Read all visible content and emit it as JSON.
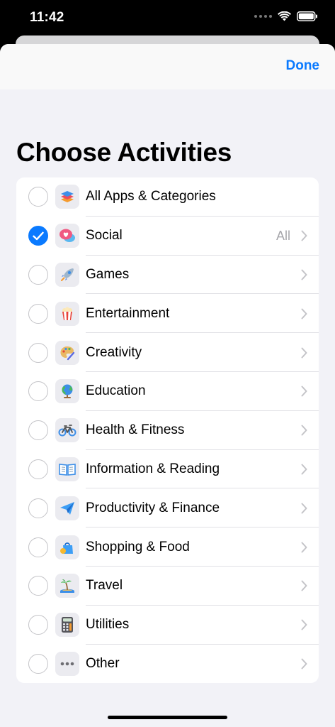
{
  "status": {
    "time": "11:42"
  },
  "nav": {
    "done_label": "Done"
  },
  "title": "Choose Activities",
  "rows": [
    {
      "label": "All Apps & Categories",
      "detail": "",
      "checked": false,
      "icon": "stack-icon",
      "chevron": false
    },
    {
      "label": "Social",
      "detail": "All",
      "checked": true,
      "icon": "social-bubbles-icon",
      "chevron": true
    },
    {
      "label": "Games",
      "detail": "",
      "checked": false,
      "icon": "rocket-icon",
      "chevron": true
    },
    {
      "label": "Entertainment",
      "detail": "",
      "checked": false,
      "icon": "popcorn-icon",
      "chevron": true
    },
    {
      "label": "Creativity",
      "detail": "",
      "checked": false,
      "icon": "palette-icon",
      "chevron": true
    },
    {
      "label": "Education",
      "detail": "",
      "checked": false,
      "icon": "globe-icon",
      "chevron": true
    },
    {
      "label": "Health & Fitness",
      "detail": "",
      "checked": false,
      "icon": "bicycle-icon",
      "chevron": true
    },
    {
      "label": "Information & Reading",
      "detail": "",
      "checked": false,
      "icon": "book-icon",
      "chevron": true
    },
    {
      "label": "Productivity & Finance",
      "detail": "",
      "checked": false,
      "icon": "paper-plane-icon",
      "chevron": true
    },
    {
      "label": "Shopping & Food",
      "detail": "",
      "checked": false,
      "icon": "shopping-bag-icon",
      "chevron": true
    },
    {
      "label": "Travel",
      "detail": "",
      "checked": false,
      "icon": "palm-island-icon",
      "chevron": true
    },
    {
      "label": "Utilities",
      "detail": "",
      "checked": false,
      "icon": "calculator-icon",
      "chevron": true
    },
    {
      "label": "Other",
      "detail": "",
      "checked": false,
      "icon": "ellipsis-icon",
      "chevron": true
    }
  ],
  "colors": {
    "accent": "#0a7aff",
    "background": "#f2f2f7"
  }
}
